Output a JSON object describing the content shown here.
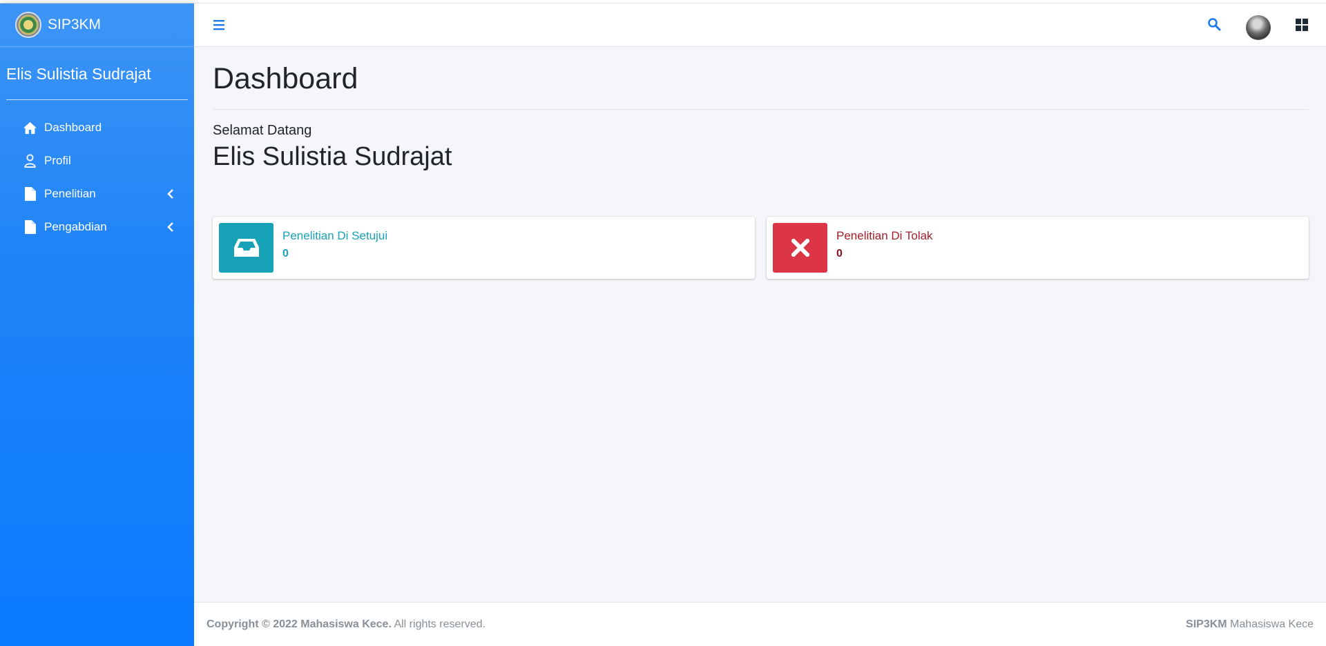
{
  "brand": {
    "name": "SIP3KM",
    "logo_icon": "university-seal-logo"
  },
  "sidebar": {
    "user_name": "Elis Sulistia Sudrajat",
    "items": [
      {
        "label": "Dashboard",
        "icon": "home-icon"
      },
      {
        "label": "Profil",
        "icon": "user-icon"
      },
      {
        "label": "Penelitian",
        "icon": "file-icon",
        "has_submenu": true
      },
      {
        "label": "Pengabdian",
        "icon": "file-icon",
        "has_submenu": true
      }
    ]
  },
  "header": {
    "icons": [
      "hamburger-icon",
      "search-icon",
      "avatar",
      "grid-icon"
    ]
  },
  "main": {
    "title": "Dashboard",
    "welcome_label": "Selamat Datang",
    "welcome_name": "Elis Sulistia Sudrajat",
    "info_boxes": [
      {
        "label": "Penelitian Di Setujui",
        "value": "0",
        "icon": "inbox-icon",
        "color": "#17a2b8"
      },
      {
        "label": "Penelitian Di Tolak",
        "value": "0",
        "icon": "times-icon",
        "color": "#dc3545"
      }
    ]
  },
  "footer": {
    "copyright_bold": "Copyright © 2022 Mahasiswa Kece.",
    "copyright_rest": " All rights reserved.",
    "right_bold": "SIP3KM",
    "right_rest": " Mahasiswa Kece"
  },
  "colors": {
    "sidebar": "#1f83f7",
    "accent": "#007bff",
    "info": "#17a2b8",
    "danger": "#dc3545",
    "content_bg": "#f4f6f9"
  }
}
